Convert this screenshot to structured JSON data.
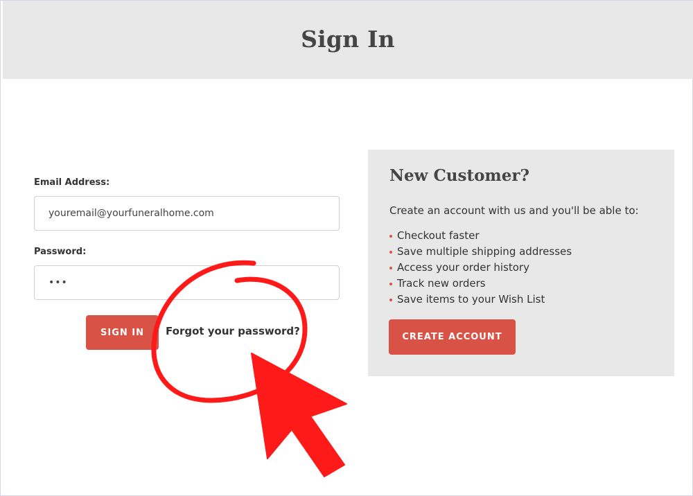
{
  "header": {
    "title": "Sign In"
  },
  "signin": {
    "email_label": "Email Address:",
    "email_value": "youremail@yourfuneralhome.com",
    "password_label": "Password:",
    "password_value": "•••",
    "signin_button": "SIGN IN",
    "forgot_link": "Forgot your password?"
  },
  "new_customer": {
    "title": "New Customer?",
    "intro": "Create an account with us and you'll be able to:",
    "benefits": [
      "Checkout faster",
      "Save multiple shipping addresses",
      "Access your order history",
      "Track new orders",
      "Save items to your Wish List"
    ],
    "create_button": "CREATE ACCOUNT"
  },
  "colors": {
    "accent": "#d85245",
    "annotation": "#ff1a1a",
    "panel_bg": "#e8e8e8"
  },
  "icons": {
    "annotation_circle": "circle-annotation-icon",
    "annotation_pointer": "arrow-pointer-icon"
  }
}
